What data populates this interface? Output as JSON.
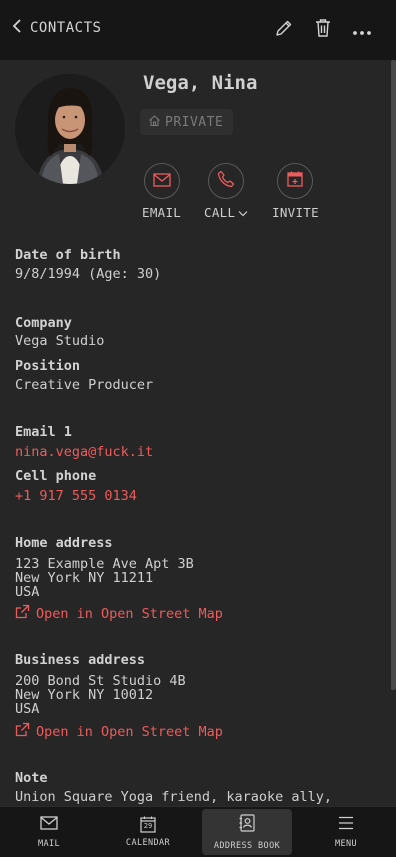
{
  "header": {
    "back_label": "CONTACTS",
    "icons": [
      "chevron-left-icon",
      "pencil-icon",
      "trash-icon",
      "more-icon"
    ]
  },
  "contact": {
    "name": "Vega, Nina",
    "badge": "PRIVATE",
    "actions": {
      "email": "EMAIL",
      "call": "CALL",
      "invite": "INVITE"
    },
    "dob_label": "Date of birth",
    "dob_value": "9/8/1994 (Age: 30)",
    "company_label": "Company",
    "company_value": "Vega Studio",
    "position_label": "Position",
    "position_value": "Creative Producer",
    "email_label": "Email 1",
    "email_value": "nina.vega@fuck.it",
    "phone_label": "Cell phone",
    "phone_value": "+1 917 555 0134",
    "home_label": "Home address",
    "home_lines": [
      "123 Example Ave Apt 3B",
      "New York NY 11211",
      "USA"
    ],
    "home_map": "Open in Open Street Map",
    "business_label": "Business address",
    "business_lines": [
      "200 Bond St Studio 4B",
      "New York NY 10012",
      "USA"
    ],
    "business_map": "Open in Open Street Map",
    "note_label": "Note",
    "note_value": "Union Square Yoga friend, karaoke ally,"
  },
  "nav": {
    "mail": "MAIL",
    "calendar": "CALENDAR",
    "calendar_day": "29",
    "address_book": "ADDRESS BOOK",
    "menu": "MENU"
  },
  "colors": {
    "accent": "#ef5b5b",
    "background": "#262626",
    "bar": "#161616"
  }
}
